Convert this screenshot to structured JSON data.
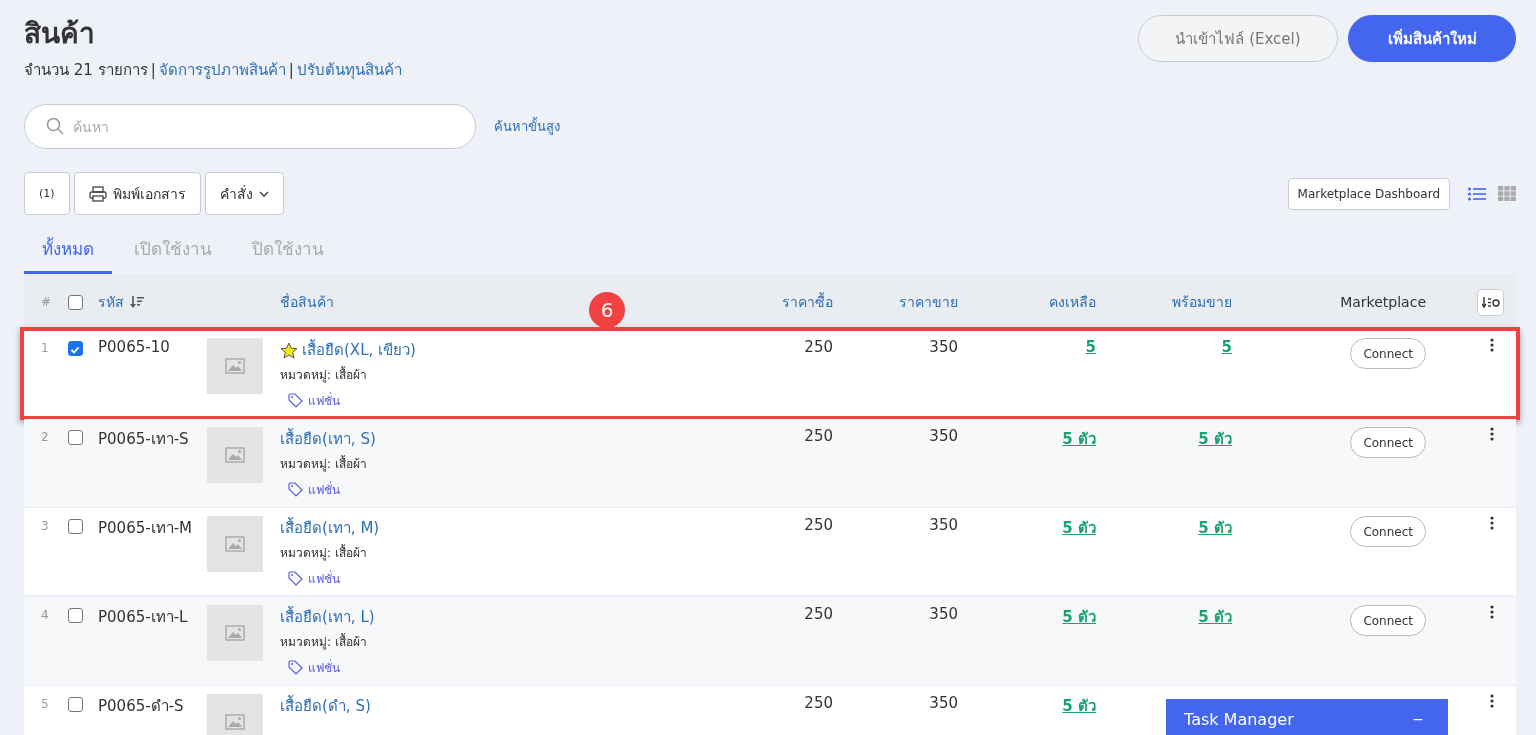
{
  "page": {
    "title": "สินค้า",
    "count_text": "จำนวน 21 รายการ",
    "separator": "|",
    "links": [
      "จัดการรูปภาพสินค้า",
      "ปรับต้นทุนสินค้า"
    ]
  },
  "header_buttons": [
    {
      "label": "นำเข้าไฟล์ (Excel)",
      "kind": "secondary"
    },
    {
      "label": "เพิ่มสินค้าใหม่",
      "kind": "primary"
    }
  ],
  "search": {
    "placeholder": "ค้นหา",
    "advanced_link": "ค้นหาขั้นสูง"
  },
  "toolbar": {
    "selected_count": "(1)",
    "print_label": "พิมพ์เอกสาร",
    "command_label": "คำสั่ง",
    "dashboard_label": "Marketplace Dashboard",
    "views": [
      {
        "kind": "list",
        "selected": true
      },
      {
        "kind": "grid",
        "selected": false
      }
    ]
  },
  "tabs": [
    {
      "label": "ทั้งหมด",
      "selected": true
    },
    {
      "label": "เปิดใช้งาน",
      "selected": false
    },
    {
      "label": "ปิดใช้งาน",
      "selected": false
    }
  ],
  "table": {
    "select_all_checked": false,
    "columns": [
      {
        "label": "#",
        "kind": "index"
      },
      {
        "label": "รหัส",
        "kind": "sort"
      },
      {
        "label": "ชื่อสินค้า",
        "kind": "link"
      },
      {
        "label": "ราคาซื้อ",
        "kind": "link"
      },
      {
        "label": "ราคาขาย",
        "kind": "link"
      },
      {
        "label": "คงเหลือ",
        "kind": "link"
      },
      {
        "label": "พร้อมขาย",
        "kind": "link"
      },
      {
        "label": "Marketplace",
        "kind": "plain"
      }
    ],
    "rows": [
      {
        "index": "1",
        "highlighted": true,
        "checked": true,
        "code": "P0065-10",
        "starred": true,
        "name": "เสื้อยืด(XL, เขียว)",
        "category": "หมวดหมู่: เสื้อผ้า",
        "tag": "แฟชั่น",
        "buy_price": "250",
        "sell_price": "350",
        "stock": "5",
        "ready": "5",
        "marketplace": "Connect"
      },
      {
        "index": "2",
        "checked": false,
        "code": "P0065-เทา-S",
        "starred": false,
        "name": "เสื้อยืด(เทา, S)",
        "category": "หมวดหมู่: เสื้อผ้า",
        "tag": "แฟชั่น",
        "buy_price": "250",
        "sell_price": "350",
        "stock": "5 ตัว",
        "ready": "5 ตัว",
        "marketplace": "Connect"
      },
      {
        "index": "3",
        "checked": false,
        "code": "P0065-เทา-M",
        "starred": false,
        "name": "เสื้อยืด(เทา, M)",
        "category": "หมวดหมู่: เสื้อผ้า",
        "tag": "แฟชั่น",
        "buy_price": "250",
        "sell_price": "350",
        "stock": "5 ตัว",
        "ready": "5 ตัว",
        "marketplace": "Connect"
      },
      {
        "index": "4",
        "checked": false,
        "code": "P0065-เทา-L",
        "starred": false,
        "name": "เสื้อยืด(เทา, L)",
        "category": "หมวดหมู่: เสื้อผ้า",
        "tag": "แฟชั่น",
        "buy_price": "250",
        "sell_price": "350",
        "stock": "5 ตัว",
        "ready": "5 ตัว",
        "marketplace": "Connect"
      },
      {
        "index": "5",
        "checked": false,
        "code": "P0065-ดำ-S",
        "starred": false,
        "name": "เสื้อยืด(ดำ, S)",
        "buy_price": "250",
        "sell_price": "350",
        "stock": "5 ตัว"
      }
    ]
  },
  "callout": {
    "number": "6"
  },
  "task_manager": {
    "title": "Task Manager",
    "minimize": "−"
  }
}
